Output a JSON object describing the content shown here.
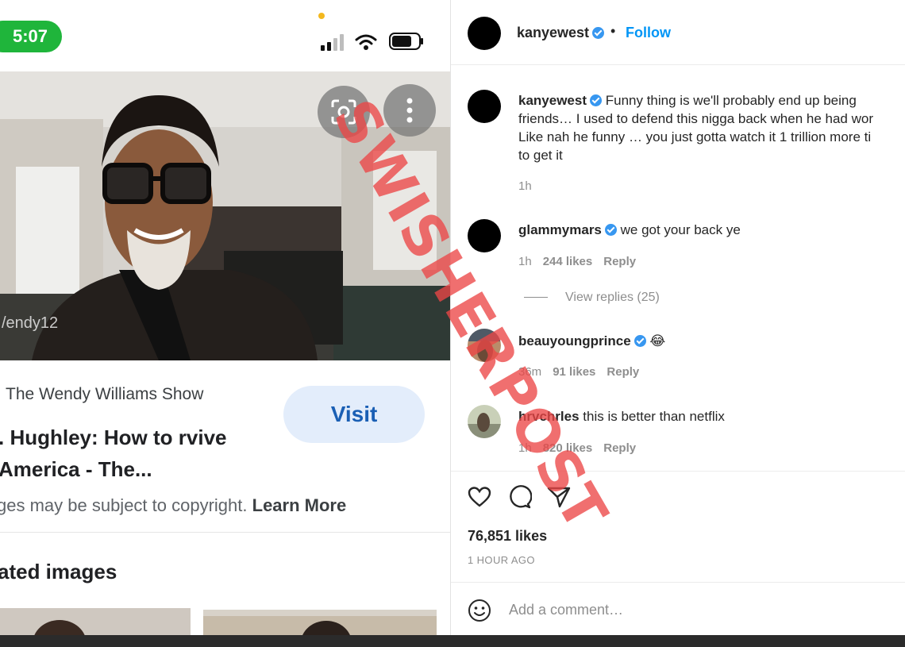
{
  "phone": {
    "status_time": "5:07",
    "icons": [
      "signal-icon",
      "wifi-icon",
      "battery-icon"
    ],
    "photo_buttons": [
      "lens-icon",
      "more-vert-icon"
    ],
    "photo_overlay_text": "/endy12",
    "source": "The Wendy Williams Show",
    "visit_label": "Visit",
    "result_title": ". Hughley: How to rvive America - The...",
    "copyright_text": "ges may be subject to copyright.",
    "learn_more": "Learn More",
    "related_heading": "ated images"
  },
  "ig": {
    "header": {
      "username": "kanyewest",
      "separator": "•",
      "follow_label": "Follow"
    },
    "comments": [
      {
        "username": "kanyewest",
        "lines": [
          "Funny thing is we'll probably end up being",
          "friends… I used to defend this nigga back when he had wor",
          "Like nah he funny … you just gotta watch it 1 trillion more ti",
          "to get it"
        ],
        "time": "1h"
      },
      {
        "username": "glammymars",
        "text": "we got your back ye",
        "time": "1h",
        "likes": "244 likes",
        "reply": "Reply"
      },
      {
        "username": "beauyoungprince",
        "text": "😂",
        "time": "36m",
        "likes": "91 likes",
        "reply": "Reply"
      },
      {
        "username": "hrvchrles",
        "text": "this is better than netflix",
        "time": "1h",
        "likes": "820 likes",
        "reply": "Reply"
      }
    ],
    "view_replies": "View replies (25)",
    "action_icons": [
      "heart-icon",
      "comment-icon",
      "share-icon"
    ],
    "likes": "76,851 likes",
    "time_ago": "1 HOUR AGO",
    "add_comment_placeholder": "Add a comment…"
  },
  "watermark": "SWISHERPOST",
  "colors": {
    "status_green": "#1fb53b",
    "ig_blue": "#0095f6",
    "visit_bg": "#e3edfb",
    "watermark": "#ec4646"
  }
}
